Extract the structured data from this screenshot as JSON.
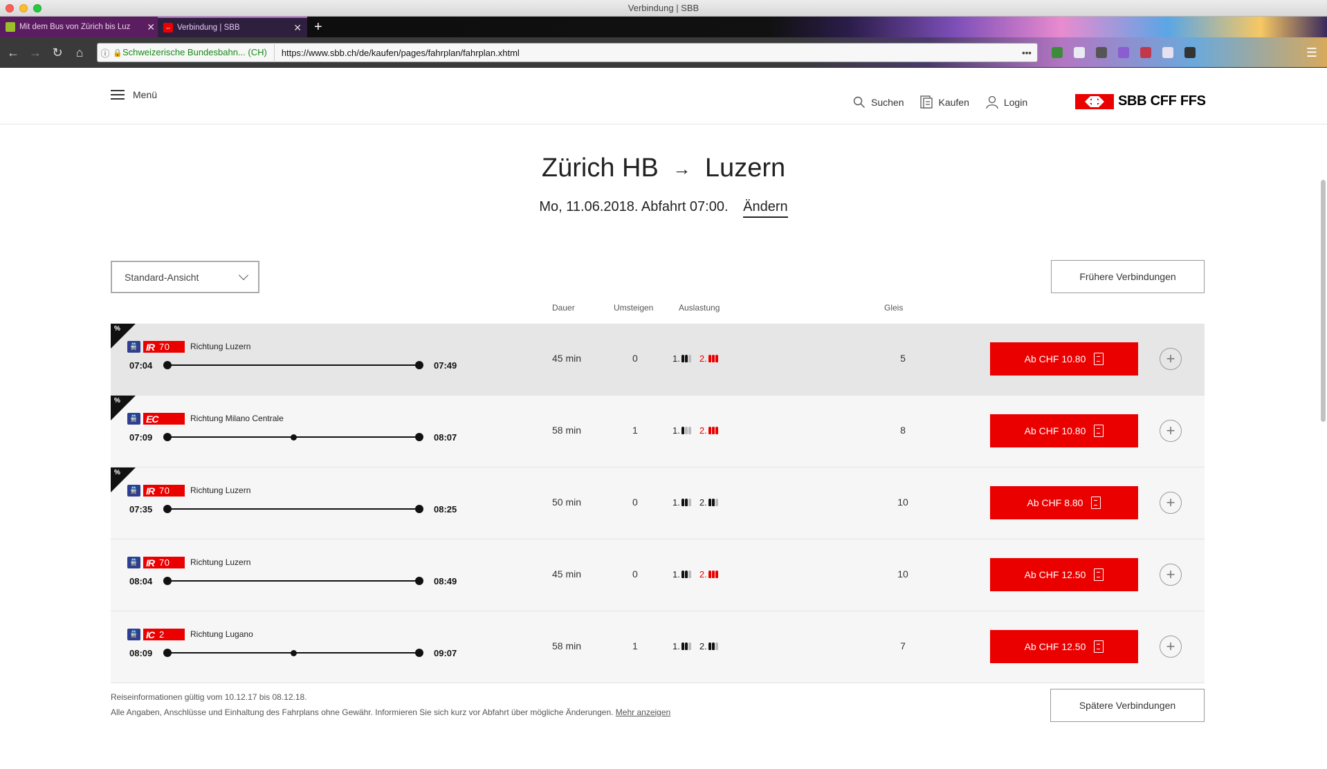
{
  "window": {
    "title": "Verbindung | SBB"
  },
  "tabs": [
    {
      "label": "Mit dem Bus von Zürich bis Luz",
      "close": "✕"
    },
    {
      "label": "Verbindung | SBB",
      "close": "✕"
    }
  ],
  "new_tab": "+",
  "address": {
    "site": "Schweizerische Bundesbahn... (CH)",
    "url": "https://www.sbb.ch/de/kaufen/pages/fahrplan/fahrplan.xhtml",
    "more": "•••"
  },
  "header": {
    "menu": "Menü",
    "search": "Suchen",
    "buy": "Kaufen",
    "login": "Login",
    "logo_text": "SBB CFF FFS"
  },
  "route": {
    "from": "Zürich HB",
    "arrow": "→",
    "to": "Luzern",
    "date_line": "Mo, 11.06.2018. Abfahrt 07:00.",
    "change": "Ändern"
  },
  "controls": {
    "view": "Standard-Ansicht",
    "earlier": "Frühere Verbindungen",
    "later": "Spätere Verbindungen"
  },
  "columns": {
    "duration": "Dauer",
    "transfers": "Umsteigen",
    "occupancy": "Auslastung",
    "platform": "Gleis"
  },
  "occupancy_labels": {
    "first": "1.",
    "second": "2."
  },
  "connections": [
    {
      "saver": "%",
      "category": "IR",
      "number": "70",
      "direction": "Richtung Luzern",
      "dep": "07:04",
      "arr": "07:49",
      "stops": 0,
      "duration": "45 min",
      "transfers": "0",
      "occ1": 2,
      "occ2": 3,
      "occ2_high": true,
      "platform": "5",
      "price": "Ab CHF 10.80",
      "active": true
    },
    {
      "saver": "%",
      "category": "EC",
      "number": "",
      "direction": "Richtung Milano Centrale",
      "dep": "07:09",
      "arr": "08:07",
      "stops": 1,
      "duration": "58 min",
      "transfers": "1",
      "occ1": 1,
      "occ2": 3,
      "occ2_high": true,
      "platform": "8",
      "price": "Ab CHF 10.80",
      "active": false
    },
    {
      "saver": "%",
      "category": "IR",
      "number": "70",
      "direction": "Richtung Luzern",
      "dep": "07:35",
      "arr": "08:25",
      "stops": 0,
      "duration": "50 min",
      "transfers": "0",
      "occ1": 2,
      "occ2": 2,
      "occ2_high": false,
      "platform": "10",
      "price": "Ab CHF 8.80",
      "active": false
    },
    {
      "saver": "",
      "category": "IR",
      "number": "70",
      "direction": "Richtung Luzern",
      "dep": "08:04",
      "arr": "08:49",
      "stops": 0,
      "duration": "45 min",
      "transfers": "0",
      "occ1": 2,
      "occ2": 3,
      "occ2_high": true,
      "platform": "10",
      "price": "Ab CHF 12.50",
      "active": false
    },
    {
      "saver": "",
      "category": "IC",
      "number": "2",
      "direction": "Richtung Lugano",
      "dep": "08:09",
      "arr": "09:07",
      "stops": 1,
      "duration": "58 min",
      "transfers": "1",
      "occ1": 2,
      "occ2": 2,
      "occ2_high": false,
      "platform": "7",
      "price": "Ab CHF 12.50",
      "active": false
    }
  ],
  "footer": {
    "validity": "Reiseinformationen gültig vom 10.12.17 bis 08.12.18.",
    "disclaimer": "Alle Angaben, Anschlüsse und Einhaltung des Fahrplans ohne Gewähr. Informieren Sie sich kurz vor Abfahrt über mögliche Änderungen.",
    "more": "Mehr anzeigen"
  },
  "colors": {
    "sbb_red": "#eb0000",
    "occupancy_high": "#eb0000",
    "train_icon": "#2f3e8f"
  }
}
